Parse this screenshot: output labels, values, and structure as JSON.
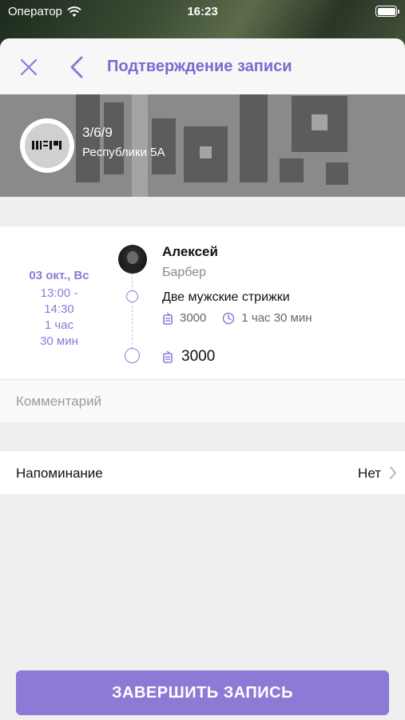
{
  "status_bar": {
    "carrier": "Оператор",
    "time": "16:23"
  },
  "nav": {
    "title": "Подтверждение записи"
  },
  "salon": {
    "name": "3/6/9",
    "address": "Республики 5А"
  },
  "appointment": {
    "date": "03 окт., Вс",
    "time_range_start": "13:00 -",
    "time_range_end": "14:30",
    "duration_line1": "1 час",
    "duration_line2": "30 мин",
    "master_name": "Алексей",
    "master_role": "Барбер",
    "service_name": "Две мужские стрижки",
    "service_price": "3000",
    "service_duration": "1 час 30 мин",
    "total_price": "3000"
  },
  "comment": {
    "placeholder": "Комментарий"
  },
  "reminder": {
    "label": "Напоминание",
    "value": "Нет"
  },
  "submit": {
    "label": "ЗАВЕРШИТЬ ЗАПИСЬ"
  },
  "colors": {
    "accent": "#8c7ad6",
    "background": "#efefef"
  }
}
